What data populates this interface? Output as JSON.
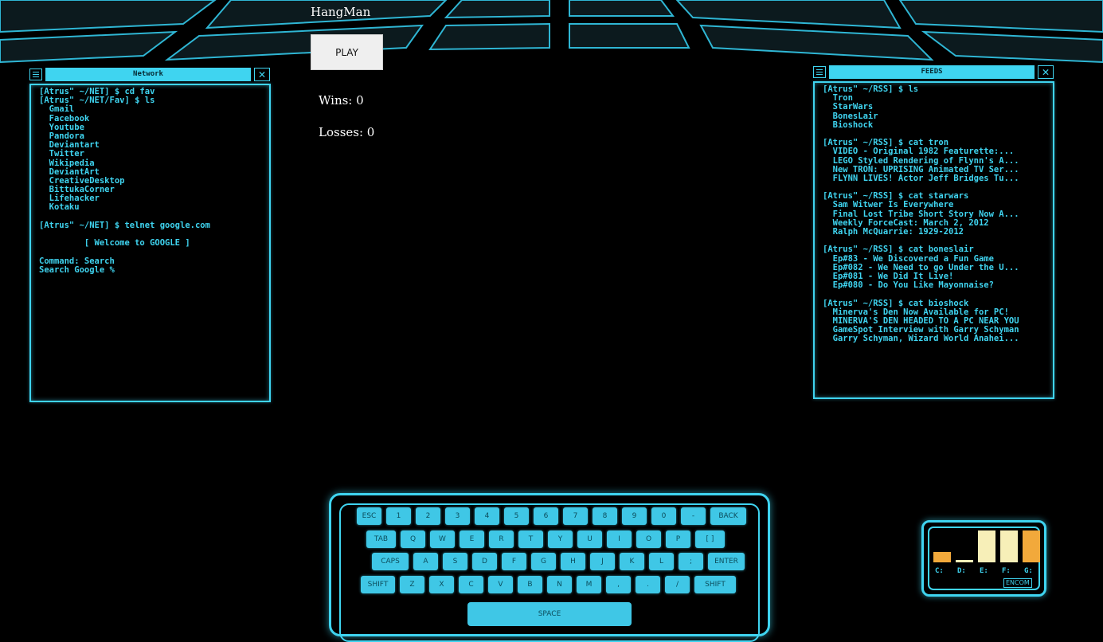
{
  "app": {
    "title": "HangMan",
    "play_label": "PLAY",
    "wins_text": "Wins: 0",
    "losses_text": "Losses: 0"
  },
  "network_window": {
    "title": "Network",
    "lines": [
      "[Atrus\" ~/NET] $ cd fav",
      "[Atrus\" ~/NET/Fav] $ ls",
      "  Gmail",
      "  Facebook",
      "  Youtube",
      "  Pandora",
      "  Deviantart",
      "  Twitter",
      "  Wikipedia",
      "  DeviantArt",
      "  CreativeDesktop",
      "  BittukaCorner",
      "  Lifehacker",
      "  Kotaku",
      "",
      "[Atrus\" ~/NET] $ telnet google.com",
      "",
      "         [ Welcome to GOOGLE ]",
      "",
      "Command: Search",
      "Search Google %"
    ]
  },
  "feeds_window": {
    "title": "FEEDS",
    "lines": [
      "[Atrus\" ~/RSS] $ ls",
      "  Tron",
      "  StarWars",
      "  BonesLair",
      "  Bioshock",
      "",
      "[Atrus\" ~/RSS] $ cat tron",
      "  VIDEO - Original 1982 Featurette:...",
      "  LEGO Styled Rendering of Flynn's A...",
      "  New TRON: UPRISING Animated TV Ser...",
      "  FLYNN LIVES! Actor Jeff Bridges Tu...",
      "",
      "[Atrus\" ~/RSS] $ cat starwars",
      "  Sam Witwer Is Everywhere",
      "  Final Lost Tribe Short Story Now A...",
      "  Weekly ForceCast: March 2, 2012",
      "  Ralph McQuarrie: 1929-2012",
      "",
      "[Atrus\" ~/RSS] $ cat boneslair",
      "  Ep#83 - We Discovered a Fun Game",
      "  Ep#082 - We Need to go Under the U...",
      "  Ep#081 - We Did It Live!",
      "  Ep#080 - Do You Like Mayonnaise?",
      "",
      "[Atrus\" ~/RSS] $ cat bioshock",
      "  Minerva's Den Now Available for PC!",
      "  MINERVA'S DEN HEADED TO A PC NEAR YOU",
      "  GameSpot Interview with Garry Schyman",
      "  Garry Schyman, Wizard World Anahei..."
    ]
  },
  "keyboard": {
    "rows": [
      [
        "ESC",
        "1",
        "2",
        "3",
        "4",
        "5",
        "6",
        "7",
        "8",
        "9",
        "0",
        "-",
        "BACK"
      ],
      [
        "TAB",
        "Q",
        "W",
        "E",
        "R",
        "T",
        "Y",
        "U",
        "I",
        "O",
        "P",
        "[ ]"
      ],
      [
        "CAPS",
        "A",
        "S",
        "D",
        "F",
        "G",
        "H",
        "J",
        "K",
        "L",
        ";",
        "ENTER"
      ],
      [
        "SHIFT",
        "Z",
        "X",
        "C",
        "V",
        "B",
        "N",
        "M",
        ",",
        ".",
        "/",
        "SHIFT"
      ]
    ],
    "space_label": "SPACE"
  },
  "disk_meter": {
    "drives": [
      {
        "label": "C:",
        "fill": 0.3,
        "color": "#f2a93b"
      },
      {
        "label": "D:",
        "fill": 0.08,
        "color": "#f7efb8"
      },
      {
        "label": "E:",
        "fill": 0.95,
        "color": "#f7efb8"
      },
      {
        "label": "F:",
        "fill": 0.95,
        "color": "#f7efb8"
      },
      {
        "label": "G:",
        "fill": 0.95,
        "color": "#f2a93b"
      }
    ],
    "brand": "ENCOM"
  },
  "theme": {
    "accent": "#3fd4f0",
    "background": "#000000"
  }
}
